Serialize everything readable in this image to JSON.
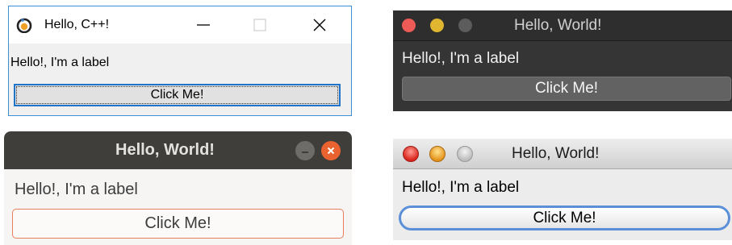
{
  "windows_win": {
    "title": "Hello, C++!",
    "label": "Hello!, I'm a label",
    "button_label": "Click Me!",
    "icon": "qt-logo-icon",
    "controls": [
      "minimize-icon",
      "maximize-icon",
      "close-icon"
    ],
    "accent": "#1f73c9"
  },
  "mac_dark": {
    "title": "Hello, World!",
    "label": "Hello!, I'm a label",
    "button_label": "Click Me!",
    "controls": [
      "close-dot-icon",
      "minimize-dot-icon",
      "zoom-dot-icon"
    ]
  },
  "ubuntu": {
    "title": "Hello, World!",
    "label": "Hello!, I'm a label",
    "button_label": "Click Me!",
    "controls": [
      "minimize-icon",
      "close-icon"
    ],
    "accent": "#e9622f"
  },
  "mac_aqua": {
    "title": "Hello, World!",
    "label": "Hello!, I'm a label",
    "button_label": "Click Me!",
    "controls": [
      "close-dot-icon",
      "minimize-dot-icon",
      "zoom-dot-icon"
    ],
    "accent": "#5b8fd8"
  }
}
